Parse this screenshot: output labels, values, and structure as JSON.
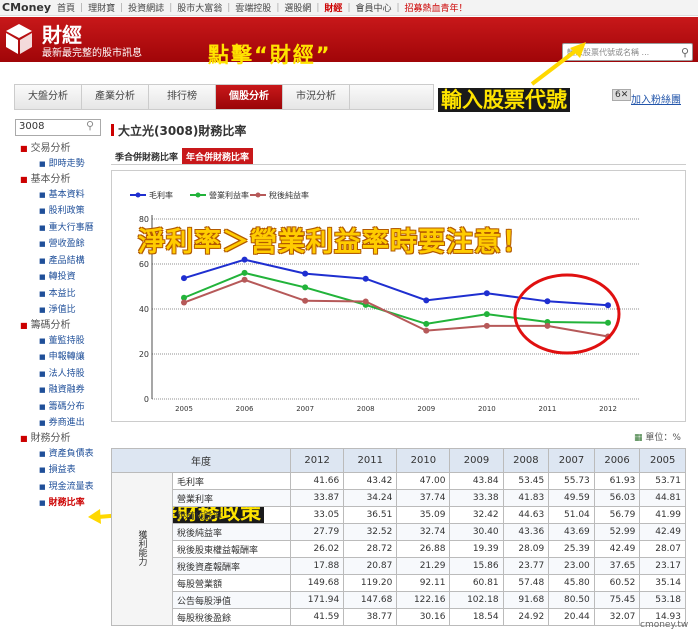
{
  "topnav": {
    "brand": "CMoney",
    "items": [
      "首頁",
      "理財寶",
      "投資網誌",
      "股市大富翁",
      "雲端控股",
      "選股網",
      "財經",
      "會員中心"
    ],
    "promo": "招募熱血青年！"
  },
  "header": {
    "title": "財經",
    "subtitle": "最新最完整的股市訊息",
    "search_placeholder": "輸入股票代號或名稱 ..."
  },
  "annotations": {
    "finance": "點擊“財經”",
    "stock_code": "輸入股票代號",
    "ratio_warning": "淨利率＞營業利益率時要注意！",
    "policy": "點擊財務政策"
  },
  "add_fav": "加入粉絲團",
  "tabs": [
    "大盤分析",
    "產業分析",
    "排行榜",
    "個股分析",
    "市況分析"
  ],
  "active_tab": "個股分析",
  "sidebar": {
    "search_value": "3008",
    "groups": [
      {
        "label": "交易分析",
        "items": [
          "即時走勢"
        ]
      },
      {
        "label": "基本分析",
        "items": [
          "基本資料",
          "股利政策",
          "重大行事曆",
          "營收盈餘",
          "產品結構",
          "轉投資",
          "本益比",
          "淨值比"
        ]
      },
      {
        "label": "籌碼分析",
        "items": [
          "董監持股",
          "申報轉讓",
          "法人持股",
          "融資融券",
          "籌碼分布",
          "券商進出"
        ]
      },
      {
        "label": "財務分析",
        "items": [
          "資產負債表",
          "損益表",
          "現金流量表",
          "財務比率"
        ]
      }
    ]
  },
  "main": {
    "title": "大立光(3008)財務比率",
    "subtabs": [
      "季合併財務比率",
      "年合併財務比率"
    ],
    "active_subtab": "年合併財務比率",
    "unit_label": "單位：%"
  },
  "chart_data": {
    "type": "line",
    "x": [
      "2005",
      "2006",
      "2007",
      "2008",
      "2009",
      "2010",
      "2011",
      "2012"
    ],
    "ylim": [
      0,
      80
    ],
    "yticks": [
      "0",
      "20",
      "40",
      "60",
      "80"
    ],
    "grid": true,
    "legend_position": "top-left",
    "series": [
      {
        "name": "毛利率",
        "color": "#1f2fd0",
        "values": [
          53.71,
          61.93,
          55.73,
          53.45,
          43.84,
          47.0,
          43.42,
          41.66
        ]
      },
      {
        "name": "營業利益率",
        "color": "#22b33a",
        "values": [
          45.0,
          56.03,
          49.59,
          41.83,
          33.38,
          37.74,
          34.24,
          33.87
        ]
      },
      {
        "name": "稅後純益率",
        "color": "#b65959",
        "values": [
          42.87,
          52.99,
          43.66,
          43.36,
          30.4,
          32.52,
          32.52,
          27.79
        ]
      }
    ]
  },
  "table": {
    "year_header": "年度",
    "years": [
      "2012",
      "2011",
      "2010",
      "2009",
      "2008",
      "2007",
      "2006",
      "2005"
    ],
    "category": "獲利能力",
    "rows": [
      {
        "label": "毛利率",
        "values": [
          "41.66",
          "43.42",
          "47.00",
          "43.84",
          "53.45",
          "55.73",
          "61.93",
          "53.71"
        ]
      },
      {
        "label": "營業利率",
        "values": [
          "33.87",
          "34.24",
          "37.74",
          "33.38",
          "41.83",
          "49.59",
          "56.03",
          "44.81"
        ]
      },
      {
        "label": "稅前純益率",
        "values": [
          "33.05",
          "36.51",
          "35.09",
          "32.42",
          "44.63",
          "51.04",
          "56.79",
          "41.99"
        ]
      },
      {
        "label": "稅後純益率",
        "values": [
          "27.79",
          "32.52",
          "32.74",
          "30.40",
          "43.36",
          "43.69",
          "52.99",
          "42.49"
        ]
      },
      {
        "label": "稅後股東權益報酬率",
        "values": [
          "26.02",
          "28.72",
          "26.88",
          "19.39",
          "28.09",
          "25.39",
          "42.49",
          "28.07"
        ]
      },
      {
        "label": "稅後資產報酬率",
        "values": [
          "17.88",
          "20.87",
          "21.29",
          "15.86",
          "23.77",
          "23.00",
          "37.65",
          "23.17"
        ]
      },
      {
        "label": "每股營業額",
        "values": [
          "149.68",
          "119.20",
          "92.11",
          "60.81",
          "57.48",
          "45.80",
          "60.52",
          "35.14"
        ]
      },
      {
        "label": "公告每股淨值",
        "values": [
          "171.94",
          "147.68",
          "122.16",
          "102.18",
          "91.68",
          "80.50",
          "75.45",
          "53.18"
        ]
      },
      {
        "label": "每股稅後盈餘",
        "values": [
          "41.59",
          "38.77",
          "30.16",
          "18.54",
          "24.92",
          "20.44",
          "32.07",
          "14.93"
        ]
      }
    ]
  },
  "watermark": "cmoney.tw"
}
